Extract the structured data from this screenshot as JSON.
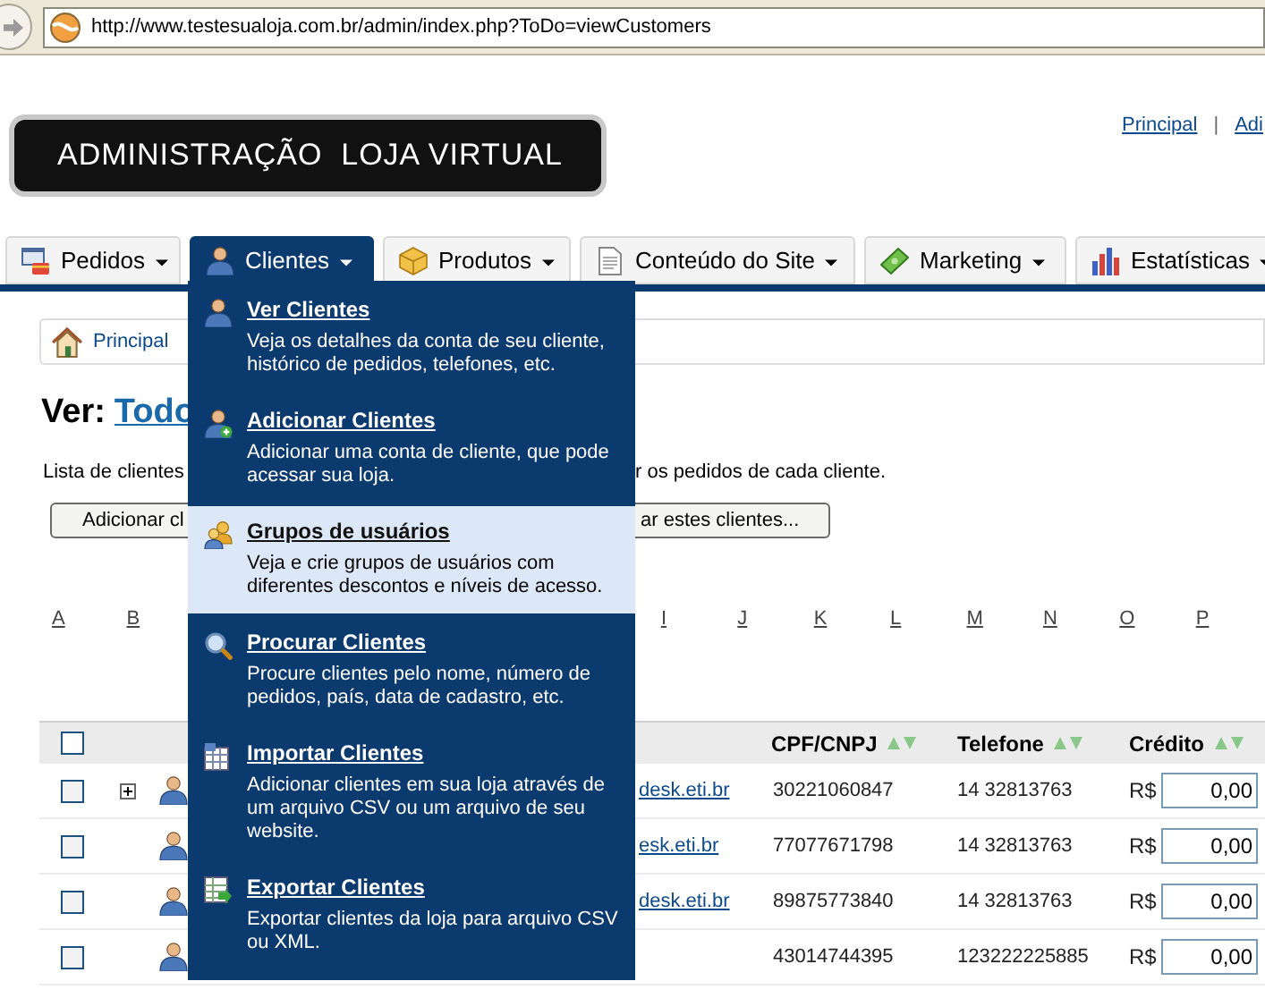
{
  "browser": {
    "url": "http://www.testesualoja.com.br/admin/index.php?ToDo=viewCustomers"
  },
  "header": {
    "logo": "ADMINISTRAÇÃO  LOJA VIRTUAL",
    "links": [
      "Principal",
      "Adi"
    ],
    "separator": "|"
  },
  "nav_tabs": [
    {
      "label": "Pedidos",
      "selected": false
    },
    {
      "label": "Clientes",
      "selected": true
    },
    {
      "label": "Produtos",
      "selected": false
    },
    {
      "label": "Conteúdo do Site",
      "selected": false
    },
    {
      "label": "Marketing",
      "selected": false
    },
    {
      "label": "Estatísticas",
      "selected": false
    }
  ],
  "menu": {
    "items": [
      {
        "title": "Ver Clientes",
        "description": "Veja os detalhes da conta de seu cliente, histórico de pedidos, telefones, etc.",
        "selected": false
      },
      {
        "title": "Adicionar Clientes",
        "description": "Adicionar uma conta de cliente, que pode acessar sua loja.",
        "selected": false
      },
      {
        "title": "Grupos de usuários",
        "description": "Veja e crie grupos de usuários com diferentes descontos e níveis de acesso.",
        "selected": true
      },
      {
        "title": "Procurar Clientes",
        "description": "Procure clientes pelo nome, número de pedidos, país, data de cadastro, etc.",
        "selected": false
      },
      {
        "title": "Importar Clientes",
        "description": "Adicionar clientes em sua loja através de um arquivo CSV ou um arquivo de seu website.",
        "selected": false
      },
      {
        "title": "Exportar Clientes",
        "description": "Exportar clientes da loja para arquivo CSV ou XML.",
        "selected": false
      }
    ]
  },
  "breadcrumb": "Principal",
  "heading": {
    "prefix": "Ver:",
    "link": "Todo"
  },
  "intro": [
    "Lista de clientes",
    "r os pedidos de cada cliente."
  ],
  "buttons": [
    "Adicionar cl",
    "ar estes clientes..."
  ],
  "letters_left": [
    "A",
    "B"
  ],
  "letters_right": [
    "I",
    "J",
    "K",
    "L",
    "M",
    "N",
    "O",
    "P"
  ],
  "table": {
    "header_checkbox": {
      "checked": false
    },
    "columns": [
      "CPF/CNPJ",
      "Telefone",
      "Crédito"
    ],
    "rows": [
      {
        "checked": false,
        "expandable": true,
        "email": "desk.eti.br",
        "cpf": "30221060847",
        "phone": "14 32813763",
        "currency": "R$",
        "credit": "0,00"
      },
      {
        "checked": false,
        "expandable": false,
        "email": "esk.eti.br",
        "cpf": "77077671798",
        "phone": "14 32813763",
        "currency": "R$",
        "credit": "0,00"
      },
      {
        "checked": false,
        "expandable": false,
        "email": "desk.eti.br",
        "cpf": "89875773840",
        "phone": "14 32813763",
        "currency": "R$",
        "credit": "0,00"
      },
      {
        "checked": false,
        "expandable": false,
        "email": "",
        "cpf": "43014744395",
        "phone": "123222225885",
        "currency": "R$",
        "credit": "0,00"
      }
    ]
  }
}
